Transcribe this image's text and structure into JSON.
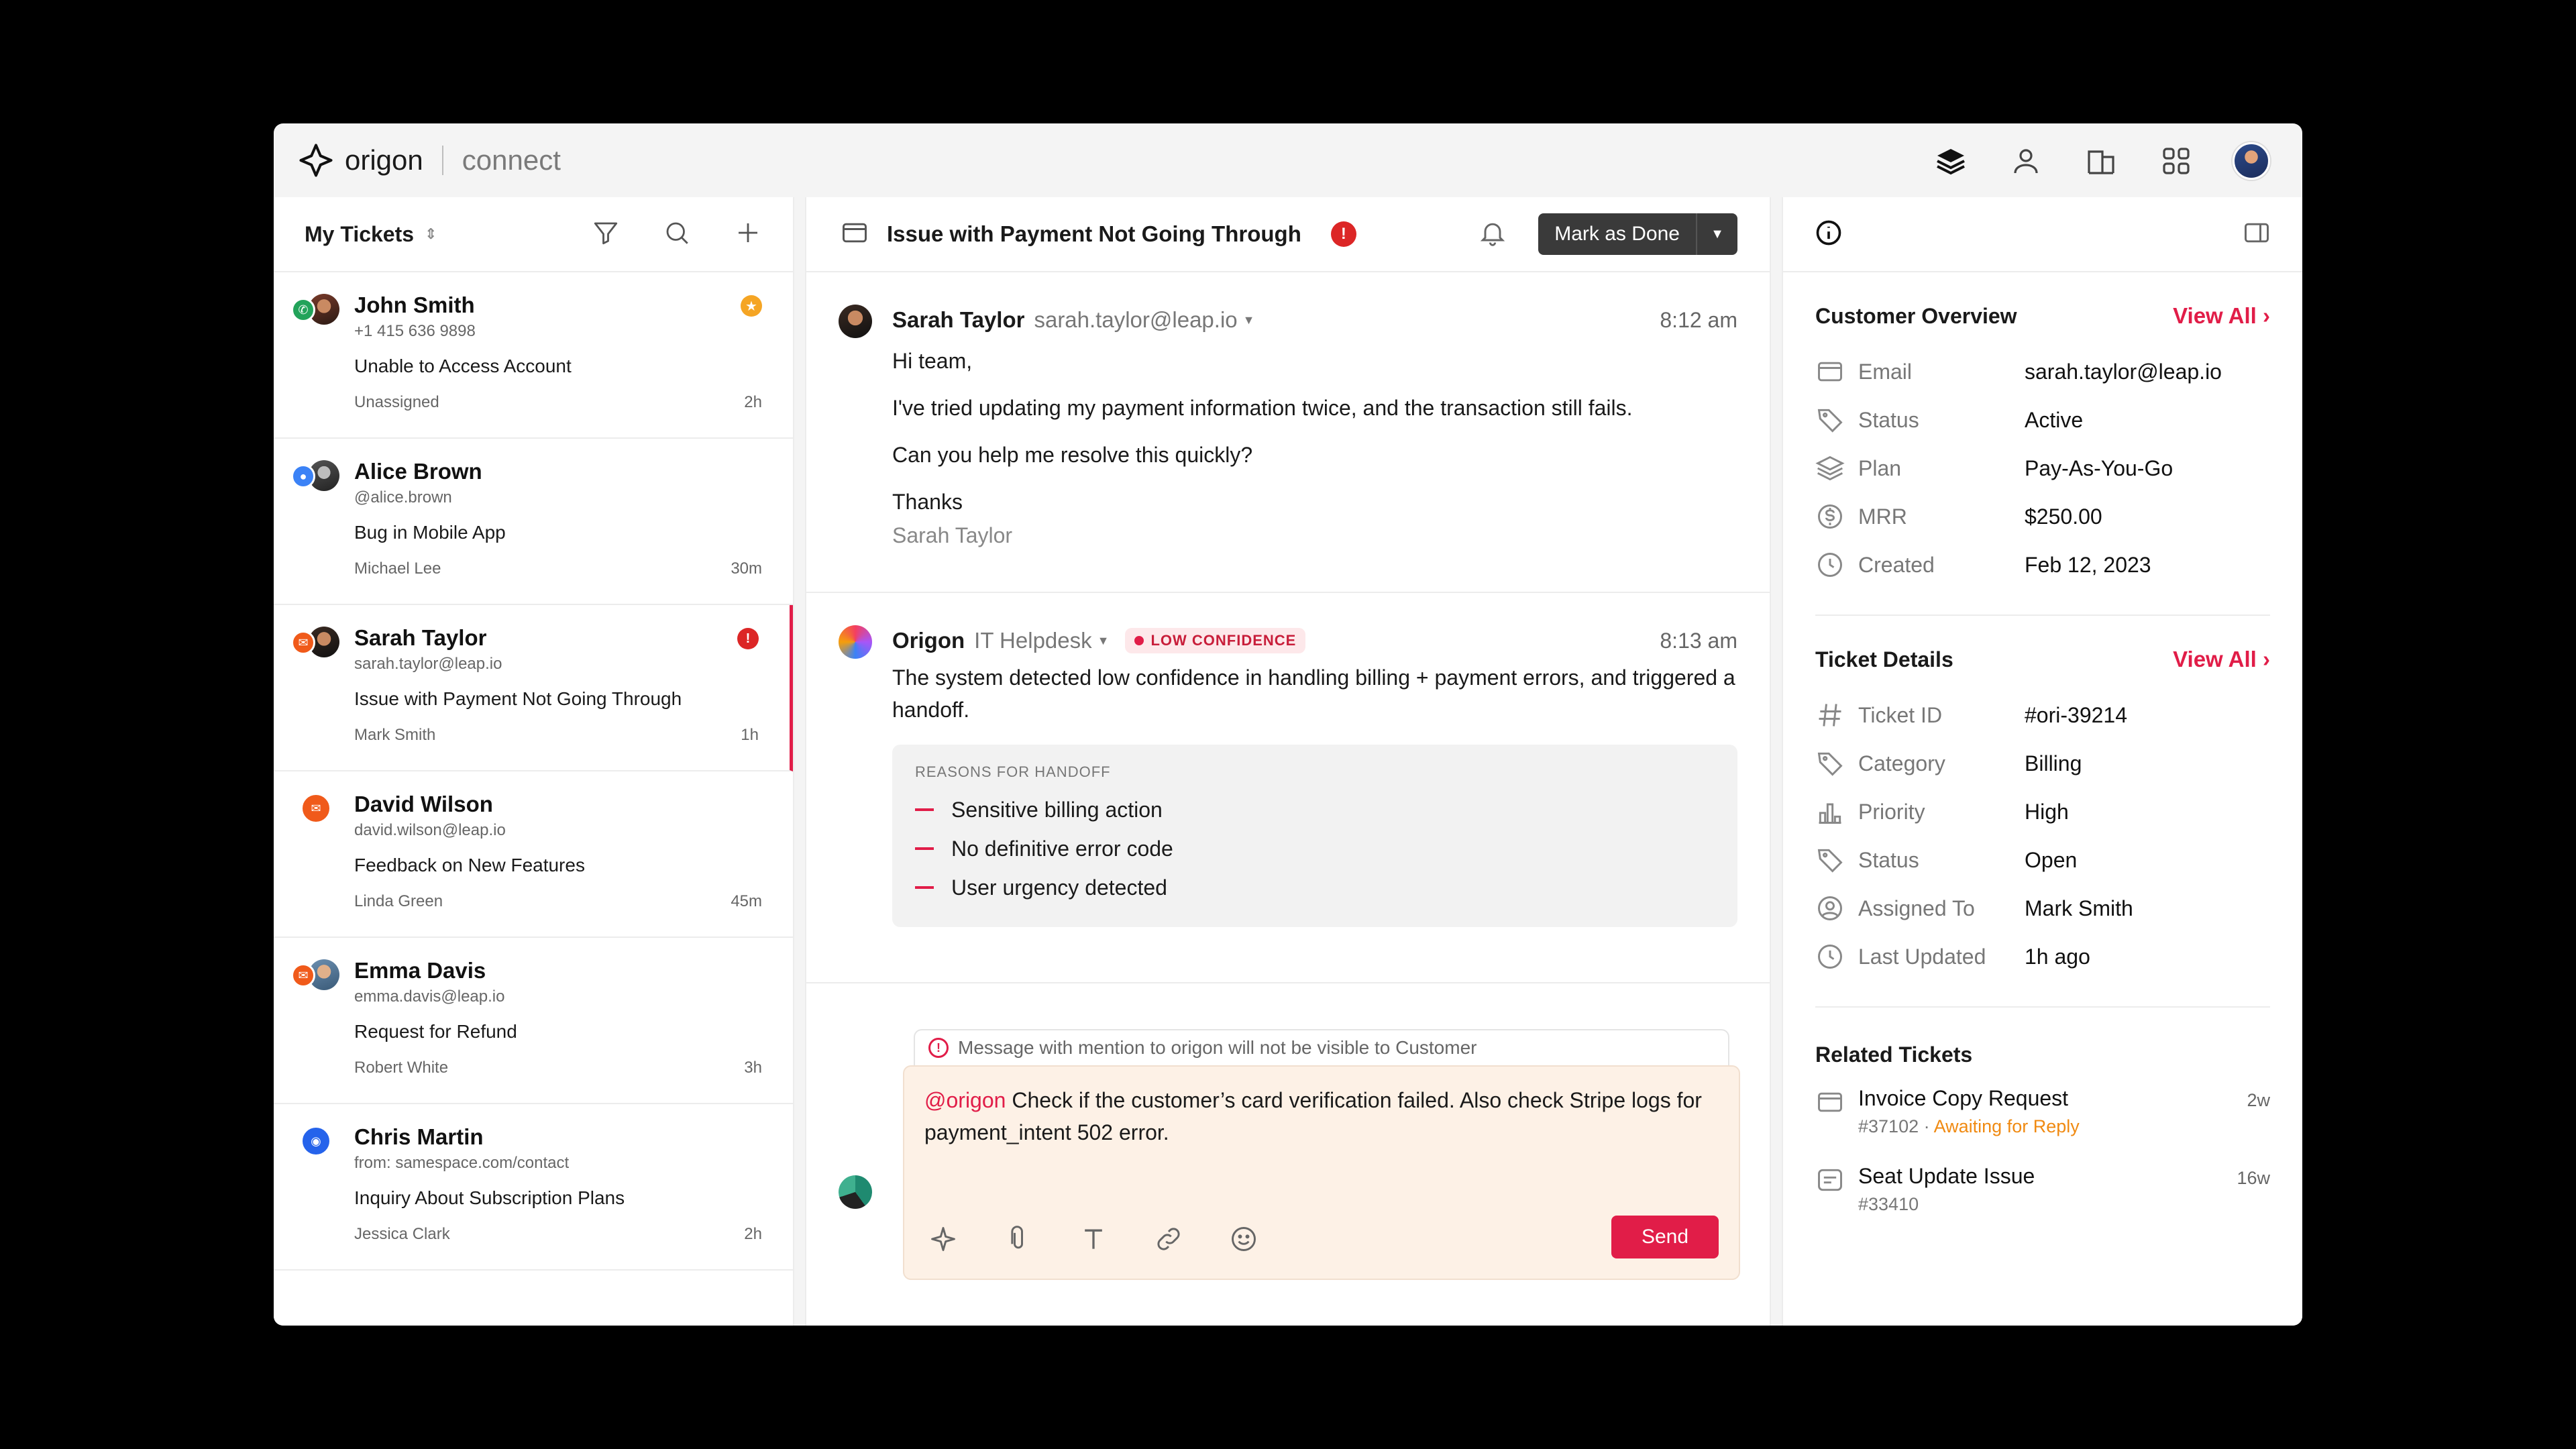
{
  "brand": {
    "name": "origon",
    "product": "connect"
  },
  "left": {
    "title": "My Tickets",
    "tickets": [
      {
        "name": "John Smith",
        "sub": "+1 415 636 9898",
        "subject": "Unable to Access Account",
        "assignee": "Unassigned",
        "age": "2h",
        "channel_color": "#22a35a",
        "flag_color": "#f5a524",
        "flag_icon": "★"
      },
      {
        "name": "Alice Brown",
        "sub": "@alice.brown",
        "subject": "Bug in Mobile App",
        "assignee": "Michael Lee",
        "age": "30m",
        "channel_color": "#3b82f6"
      },
      {
        "name": "Sarah Taylor",
        "sub": "sarah.taylor@leap.io",
        "subject": "Issue with Payment Not Going Through",
        "assignee": "Mark Smith",
        "age": "1h",
        "channel_color": "#f05a1a",
        "flag_color": "#dc2626",
        "flag_icon": "!"
      },
      {
        "name": "David Wilson",
        "sub": "david.wilson@leap.io",
        "subject": "Feedback on New Features",
        "assignee": "Linda Green",
        "age": "45m",
        "channel_color": "#f05a1a"
      },
      {
        "name": "Emma Davis",
        "sub": "emma.davis@leap.io",
        "subject": "Request for Refund",
        "assignee": "Robert White",
        "age": "3h",
        "channel_color": "#f05a1a"
      },
      {
        "name": "Chris Martin",
        "sub": "from: samespace.com/contact",
        "subject": "Inquiry About Subscription Plans",
        "assignee": "Jessica Clark",
        "age": "2h",
        "channel_color": "#2563eb"
      }
    ]
  },
  "middle": {
    "title": "Issue with Payment Not Going Through",
    "alert_icon": "!",
    "done_label": "Mark as Done",
    "message1": {
      "sender": "Sarah Taylor",
      "email": "sarah.taylor@leap.io",
      "time": "8:12 am",
      "lines": [
        "Hi team,",
        "I've tried updating my payment information twice, and the transaction still fails.",
        "Can you help me resolve this quickly?",
        "Thanks"
      ],
      "signature": "Sarah Taylor"
    },
    "message2": {
      "sender": "Origon",
      "team": "IT Helpdesk",
      "badge": "LOW CONFIDENCE",
      "time": "8:13 am",
      "text": "The system detected low confidence in handling billing + payment errors, and triggered a handoff.",
      "reasons_title": "REASONS FOR HANDOFF",
      "reasons": [
        "Sensitive billing action",
        "No definitive error code",
        "User urgency detected"
      ]
    },
    "compose": {
      "notice": "Message with mention to origon will not be visible to Customer",
      "mention": "@origon",
      "text": " Check if the customer’s card verification failed. Also check Stripe logs for payment_intent 502 error.",
      "send_label": "Send"
    }
  },
  "right": {
    "overview": {
      "title": "Customer Overview",
      "view_all": "View All",
      "rows": [
        {
          "icon": "mail-icon",
          "label": "Email",
          "value": "sarah.taylor@leap.io"
        },
        {
          "icon": "tag-icon",
          "label": "Status",
          "value": "Active"
        },
        {
          "icon": "layers-icon",
          "label": "Plan",
          "value": "Pay-As-You-Go"
        },
        {
          "icon": "dollar-icon",
          "label": "MRR",
          "value": "$250.00"
        },
        {
          "icon": "clock-icon",
          "label": "Created",
          "value": "Feb 12, 2023"
        }
      ]
    },
    "details": {
      "title": "Ticket Details",
      "view_all": "View All",
      "rows": [
        {
          "icon": "hash-icon",
          "label": "Ticket ID",
          "value": "#ori-39214"
        },
        {
          "icon": "tag-icon",
          "label": "Category",
          "value": "Billing"
        },
        {
          "icon": "bar-chart-icon",
          "label": "Priority",
          "value": "High"
        },
        {
          "icon": "tag-icon",
          "label": "Status",
          "value": "Open"
        },
        {
          "icon": "user-circle-icon",
          "label": "Assigned To",
          "value": "Mark Smith"
        },
        {
          "icon": "clock-icon",
          "label": "Last Updated",
          "value": "1h ago"
        }
      ]
    },
    "related": {
      "title": "Related Tickets",
      "items": [
        {
          "title": "Invoice Copy Request",
          "id": "#37102",
          "status": "Awaiting for Reply",
          "age": "2w"
        },
        {
          "title": "Seat Update Issue",
          "id": "#33410",
          "age": "16w"
        }
      ]
    }
  }
}
